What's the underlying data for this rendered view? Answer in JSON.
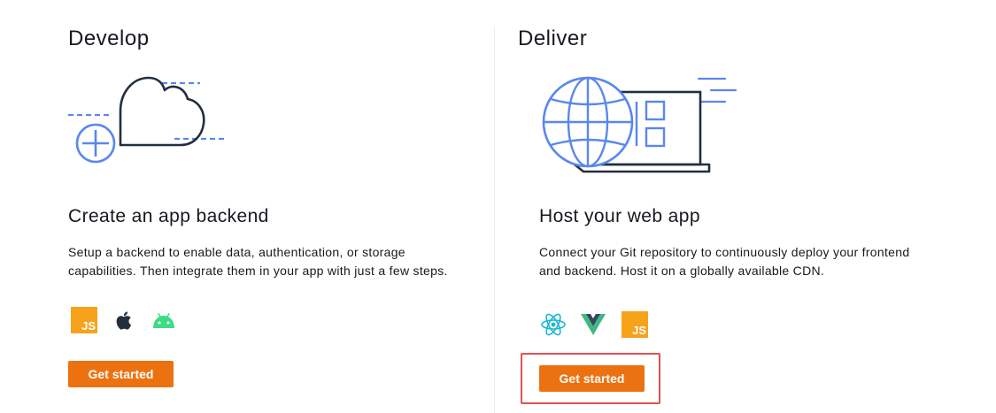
{
  "develop": {
    "section_title": "Develop",
    "card_title": "Create an app backend",
    "description": "Setup a backend to enable data, authentication, or storage capabilities. Then integrate them in your app with just a few steps.",
    "icons": [
      "javascript-icon",
      "apple-icon",
      "android-icon"
    ],
    "button_label": "Get started"
  },
  "deliver": {
    "section_title": "Deliver",
    "card_title": "Host your web app",
    "description": "Connect your Git repository to continuously deploy your frontend and backend. Host it on a globally available CDN.",
    "icons": [
      "react-icon",
      "vue-icon",
      "javascript-icon"
    ],
    "button_label": "Get started"
  },
  "js_label": "JS",
  "colors": {
    "accent": "#ec7211",
    "illustration_blue": "#5a87ee",
    "illustration_dark": "#232f3e",
    "highlight_red": "#e05252",
    "js_yellow": "#f7a21b",
    "android_green": "#3ddc84",
    "react_blue": "#1ab5d4",
    "vue_green": "#41b883",
    "vue_dark": "#35495e"
  }
}
